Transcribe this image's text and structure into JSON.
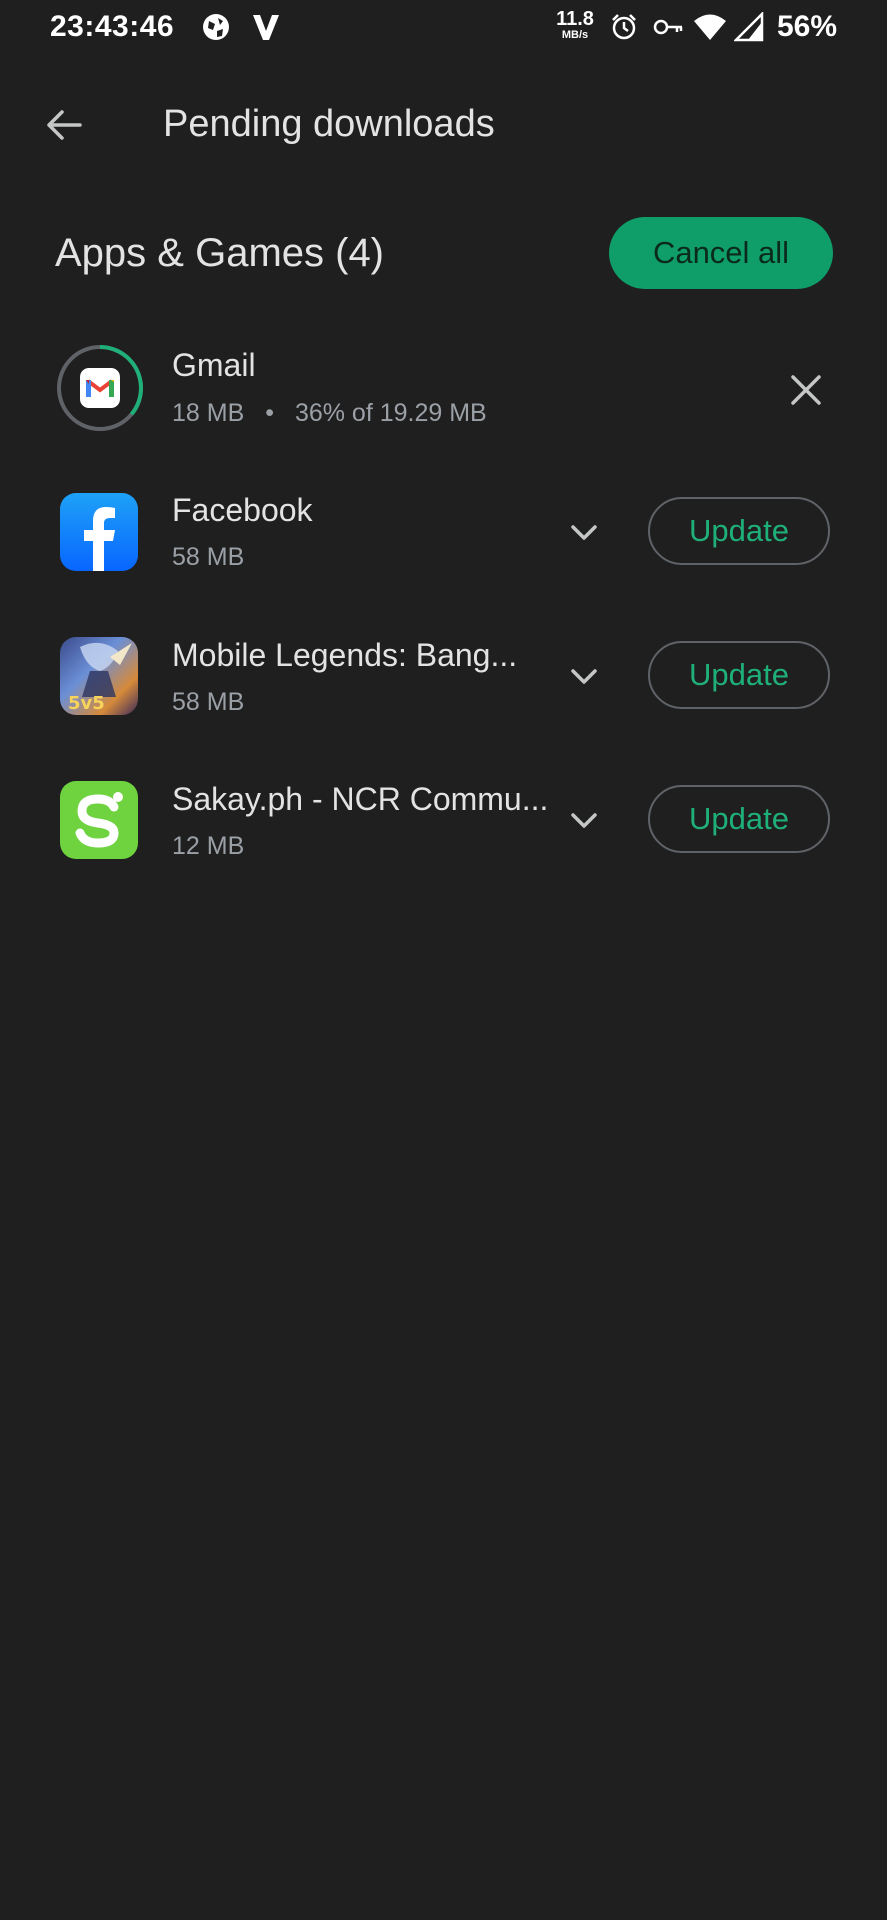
{
  "status_bar": {
    "time": "23:43:46",
    "net_speed_value": "11.8",
    "net_speed_unit": "MB/s",
    "battery": "56%",
    "icons": [
      "world-icon",
      "v-logo-icon",
      "alarm-icon",
      "vpn-key-icon",
      "wifi-icon",
      "signal-icon"
    ]
  },
  "header": {
    "title": "Pending downloads"
  },
  "section": {
    "title": "Apps & Games (4)",
    "cancel_all_label": "Cancel all"
  },
  "apps": [
    {
      "name": "Gmail",
      "size": "18 MB",
      "separator": "•",
      "progress_text": "36% of 19.29 MB",
      "progress": 0.36,
      "icon": "gmail-icon"
    },
    {
      "name": "Facebook",
      "size": "58 MB",
      "action": "Update",
      "icon": "facebook-icon"
    },
    {
      "name": "Mobile Legends: Bang...",
      "size": "58 MB",
      "action": "Update",
      "icon": "mobile-legends-icon"
    },
    {
      "name": "Sakay.ph - NCR Commu...",
      "size": "12 MB",
      "action": "Update",
      "icon": "sakay-icon"
    }
  ],
  "colors": {
    "background": "#1f1f1f",
    "accent": "#0f9d6a",
    "accent_text": "#1fb07a"
  }
}
